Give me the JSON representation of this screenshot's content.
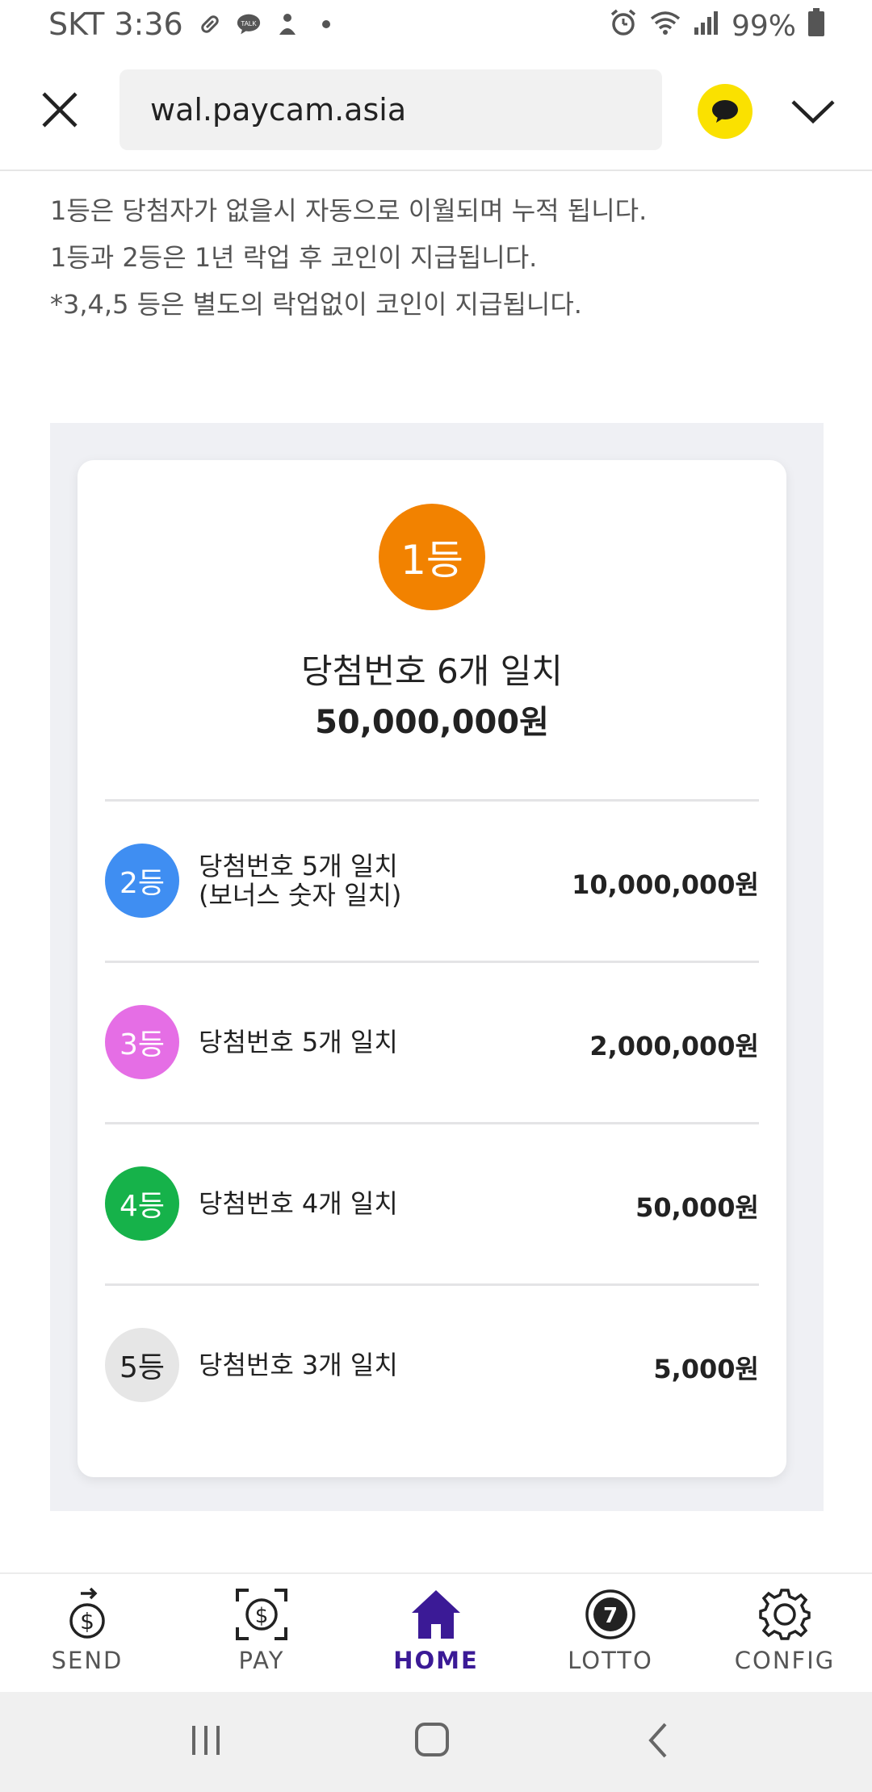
{
  "status_bar": {
    "carrier_time": "SKT 3:36",
    "talk_badge": "TALK",
    "battery": "99%",
    "icons": [
      "pill-icon",
      "kakaotalk-icon",
      "notification-icon",
      "dot-icon",
      "alarm-icon",
      "wifi-icon",
      "signal-icon",
      "battery-icon"
    ]
  },
  "browser": {
    "url": "wal.paycam.asia",
    "accent_color": "#fae100"
  },
  "notice": {
    "line1": "1등은 당첨자가 없을시 자동으로 이월되며 누적 됩니다.",
    "line2": "1등과 2등은 1년 락업 후 코인이 지급됩니다.",
    "line3": "*3,4,5 등은 별도의 락업없이 코인이 지급됩니다."
  },
  "first_prize": {
    "rank": "1등",
    "condition": "당첨번호 6개 일치",
    "amount": "50,000,000원",
    "color": "#f28200"
  },
  "prizes": [
    {
      "rank": "2등",
      "condition": "당첨번호 5개 일치",
      "condition_sub": "(보너스 숫자 일치)",
      "amount": "10,000,000원",
      "color": "#3f8ef2"
    },
    {
      "rank": "3등",
      "condition": "당첨번호 5개 일치",
      "amount": "2,000,000원",
      "color": "#e56ee5"
    },
    {
      "rank": "4등",
      "condition": "당첨번호 4개 일치",
      "amount": "50,000원",
      "color": "#16b24a"
    },
    {
      "rank": "5등",
      "condition": "당첨번호 3개 일치",
      "amount": "5,000원",
      "color": "#e6e6e6"
    }
  ],
  "bottom_nav": {
    "send": "SEND",
    "pay": "PAY",
    "home": "HOME",
    "lotto": "LOTTO",
    "config": "CONFIG",
    "lotto_number": "7",
    "active": "HOME",
    "active_color": "#3b1a96"
  }
}
